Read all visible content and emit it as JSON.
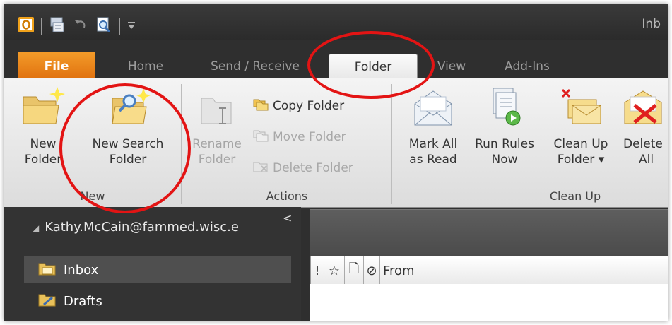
{
  "window": {
    "title_partial": "Inb"
  },
  "tabs": [
    {
      "label": "File"
    },
    {
      "label": "Home"
    },
    {
      "label": "Send / Receive"
    },
    {
      "label": "Folder"
    },
    {
      "label": "View"
    },
    {
      "label": "Add-Ins"
    }
  ],
  "ribbon": {
    "new_group": {
      "label": "New",
      "new_folder": [
        "New",
        "Folder"
      ],
      "new_search_folder": [
        "New Search",
        "Folder"
      ]
    },
    "actions_group": {
      "label": "Actions",
      "rename_folder": [
        "Rename",
        "Folder"
      ],
      "copy_folder": "Copy Folder",
      "move_folder": "Move Folder",
      "delete_folder": "Delete Folder"
    },
    "cleanup_group": {
      "label": "Clean Up",
      "mark_all_read": [
        "Mark All",
        "as Read"
      ],
      "run_rules": [
        "Run Rules",
        "Now"
      ],
      "clean_up_folder": [
        "Clean Up",
        "Folder ▾"
      ],
      "delete_all": [
        "Delete",
        "All"
      ]
    }
  },
  "nav": {
    "collapse_glyph": "<",
    "account": "Kathy.McCain@fammed.wisc.e",
    "folders": [
      "Inbox",
      "Drafts"
    ]
  },
  "list": {
    "col_importance": "!",
    "col_reminder": "☆",
    "col_icon": "🗋",
    "col_attach": "⊘",
    "col_from": "From"
  },
  "colors": {
    "file_tab": "#e87f1a",
    "annotation": "#e31414"
  }
}
